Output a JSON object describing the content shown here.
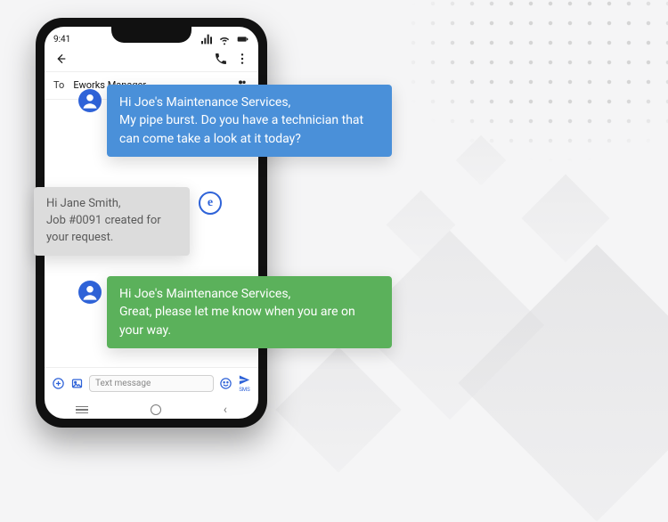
{
  "status": {
    "time": "9:41"
  },
  "recipient": {
    "to_label": "To",
    "name": "Eworks Manager"
  },
  "input": {
    "placeholder": "Text message",
    "send_label": "SMS"
  },
  "icons": {
    "back": "back-arrow-icon",
    "call": "phone-icon",
    "more": "more-vert-icon",
    "recipients": "group-add-icon",
    "add": "plus-circle-icon",
    "gallery": "image-icon",
    "emoji": "smile-icon",
    "send": "send-icon",
    "signal": "signal-icon",
    "wifi": "wifi-icon",
    "battery": "battery-icon"
  },
  "bubbles": {
    "incoming1": "Hi Joe's Maintenance Services,\nMy pipe burst. Do you have a technician that can come take a look at it today?",
    "reply1": "Hi Jane Smith,\nJob #0091 created for your request.",
    "incoming2": "Hi Joe's Maintenance Services,\nGreat, please let me know when you are on your way."
  },
  "colors": {
    "blue": "#4a90d9",
    "green": "#5bb15b",
    "grey": "#dcdcdc",
    "accent": "#2f63d8"
  }
}
